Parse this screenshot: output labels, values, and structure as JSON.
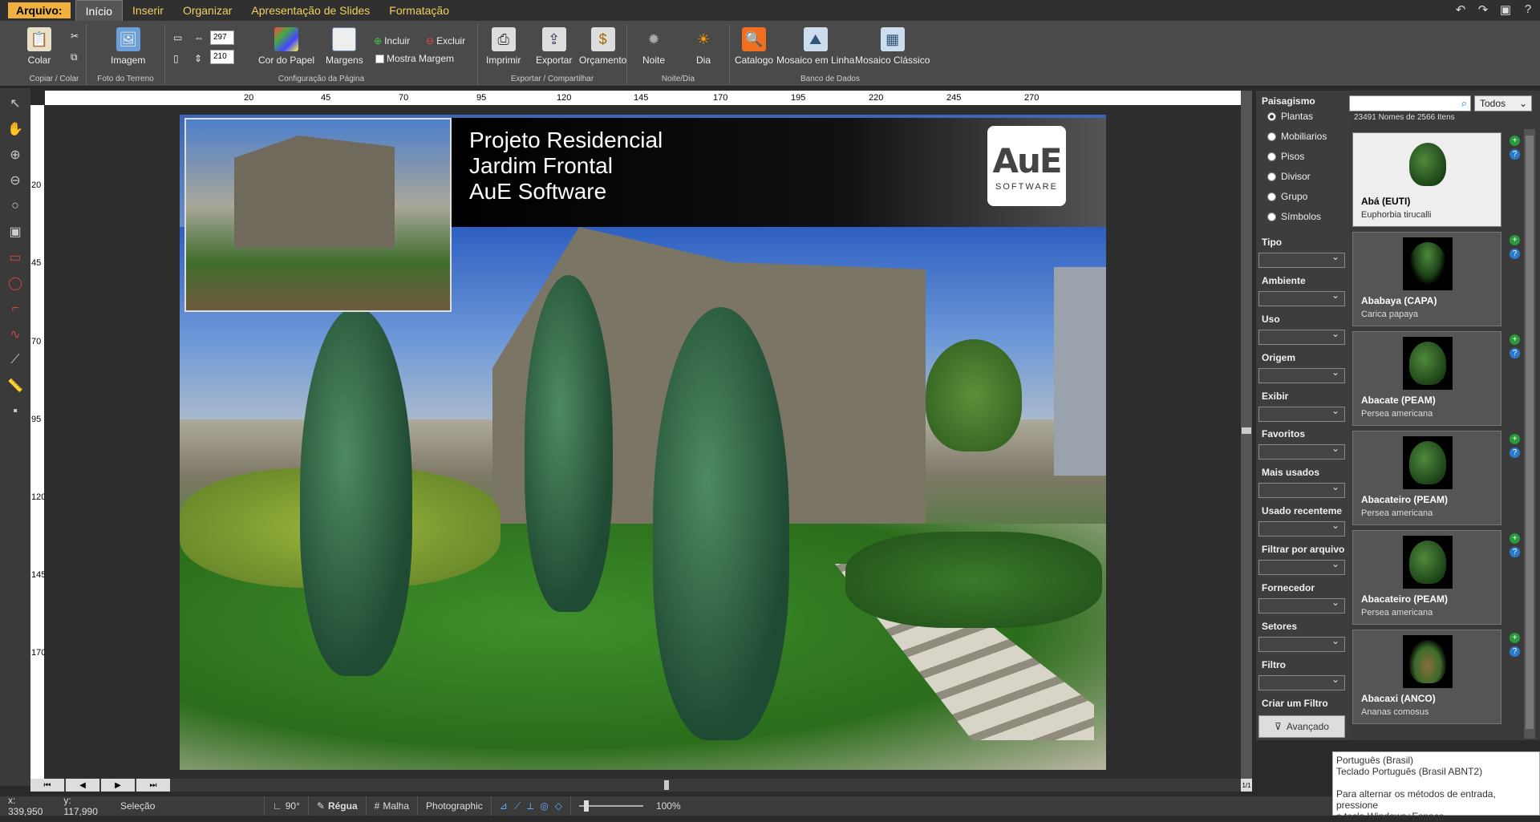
{
  "menu": {
    "file": "Arquivo:",
    "tabs": [
      "Início",
      "Inserir",
      "Organizar",
      "Apresentação de Slides",
      "Formatação"
    ]
  },
  "ribbon": {
    "paste": "Colar",
    "copy_group": "Copiar / Colar",
    "image": "Imagem",
    "terrain_group": "Foto do Terreno",
    "width_value": "297",
    "height_value": "210",
    "paper_color": "Cor do Papel",
    "margins": "Margens",
    "include": "Incluir",
    "exclude": "Excluir",
    "show_margin": "Mostra Margem",
    "page_group": "Configuração da Página",
    "print": "Imprimir",
    "export": "Exportar",
    "budget": "Orçamento",
    "export_group": "Exportar / Compartilhar",
    "night": "Noite",
    "day": "Dia",
    "daynight_group": "Noite/Dia",
    "catalog": "Catalogo",
    "online_mosaic": "Mosaico em Linha",
    "classic_mosaic": "Mosaico Clássico",
    "db_group": "Banco de Dados"
  },
  "ruler": {
    "top": [
      "20",
      "45",
      "70",
      "95",
      "120",
      "145",
      "170",
      "195",
      "220",
      "245",
      "270"
    ],
    "left": [
      "20",
      "45",
      "70",
      "95",
      "120",
      "145",
      "170"
    ]
  },
  "slide": {
    "title_lines": [
      "Projeto Residencial",
      "Jardim Frontal",
      "AuE Software"
    ],
    "logo_text": "AuE",
    "logo_sub": "SOFTWARE"
  },
  "page_counter": "1/1",
  "filters": {
    "heading": "Paisagismo",
    "radios": [
      "Plantas",
      "Mobiliarios",
      "Pisos",
      "Divisor",
      "Grupo",
      "Símbolos"
    ],
    "selected": "Plantas",
    "fields": [
      "Tipo",
      "Ambiente",
      "Uso",
      "Origem",
      "Exibir",
      "Favoritos",
      "Mais usados",
      "Usado recenteme",
      "Filtrar por arquivo",
      "Fornecedor",
      "Setores",
      "Filtro"
    ],
    "create_filter": "Criar um Filtro",
    "advanced": "Avançado"
  },
  "catalog": {
    "search_placeholder": "",
    "scope": "Todos",
    "count": "23491 Nomes de 2566 Itens",
    "items": [
      {
        "name": "Abá (EUTI)",
        "sci": "Euphorbia tirucalli"
      },
      {
        "name": "Ababaya (CAPA)",
        "sci": "Carica papaya"
      },
      {
        "name": "Abacate (PEAM)",
        "sci": "Persea americana"
      },
      {
        "name": "Abacateiro (PEAM)",
        "sci": "Persea americana"
      },
      {
        "name": "Abacateiro (PEAM)",
        "sci": "Persea americana"
      },
      {
        "name": "Abacaxi (ANCO)",
        "sci": "Ananas comosus"
      }
    ]
  },
  "status": {
    "x": "x: 339,950",
    "y": "y: 117,990",
    "mode": "Seleção",
    "angle": "90°",
    "ruler": "Régua",
    "grid": "Malha",
    "style": "Photographic",
    "zoom": "100%"
  },
  "tooltip": {
    "line1": "Português (Brasil)",
    "line2": "Teclado Português (Brasil ABNT2)",
    "line3": "Para alternar os métodos de entrada, pressione",
    "line4": "a tecla Windows+Espaço."
  },
  "colors": {
    "accent": "#f0b040",
    "menu_text": "#f0d060"
  }
}
